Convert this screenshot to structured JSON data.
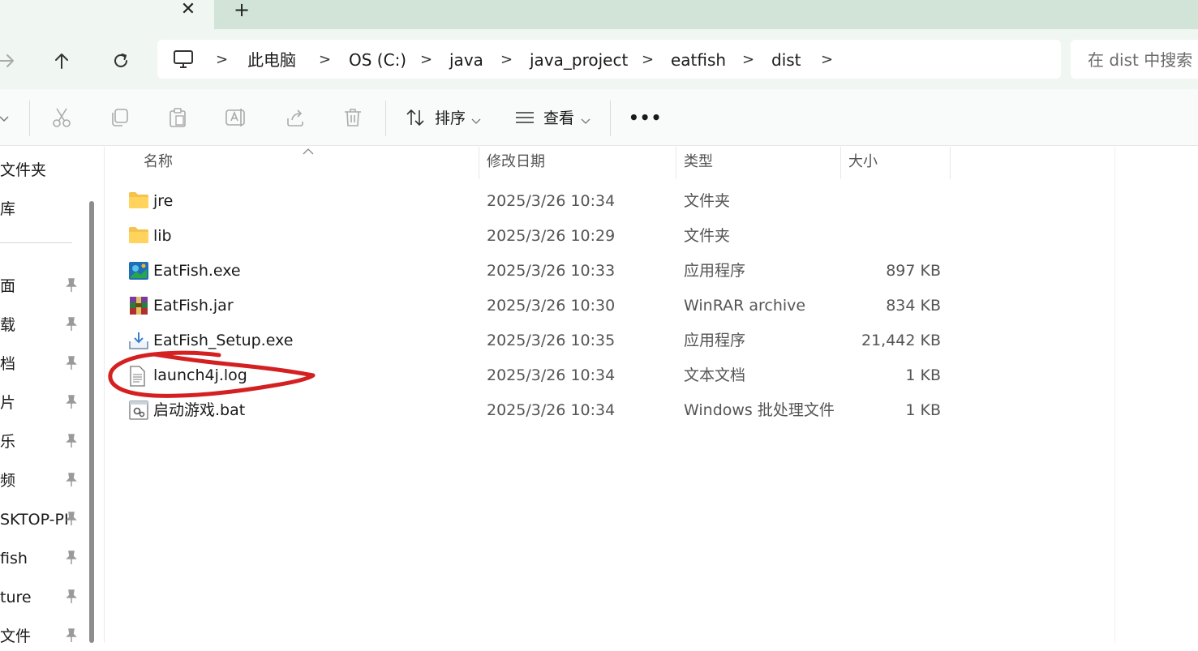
{
  "tabs": {
    "close_glyph": "✕",
    "new_tab_glyph": "+"
  },
  "address": {
    "crumbs": [
      "此电脑",
      "OS (C:)",
      "java",
      "java_project",
      "eatfish",
      "dist"
    ],
    "separator": ">",
    "icon": "computer-icon"
  },
  "search": {
    "placeholder": "在 dist 中搜索"
  },
  "toolbar": {
    "sort_label": "排序",
    "view_label": "查看",
    "more_label": "•••",
    "icons": [
      "cut-icon",
      "copy-icon",
      "paste-icon",
      "rename-icon",
      "share-icon",
      "delete-icon"
    ]
  },
  "sidebar": {
    "items": [
      {
        "label": "文件夹",
        "pinned": false
      },
      {
        "label": "库",
        "pinned": false
      },
      {
        "label": "面",
        "pinned": true
      },
      {
        "label": "载",
        "pinned": true
      },
      {
        "label": "档",
        "pinned": true
      },
      {
        "label": "片",
        "pinned": true
      },
      {
        "label": "乐",
        "pinned": true
      },
      {
        "label": "频",
        "pinned": true
      },
      {
        "label": "SKTOP-PI",
        "pinned": true
      },
      {
        "label": "fish",
        "pinned": true
      },
      {
        "label": "ture",
        "pinned": true
      },
      {
        "label": "文件",
        "pinned": true
      }
    ]
  },
  "columns": {
    "name": "名称",
    "date": "修改日期",
    "type": "类型",
    "size": "大小"
  },
  "files": [
    {
      "name": "jre",
      "date": "2025/3/26 10:34",
      "type": "文件夹",
      "size": "",
      "icon": "folder-icon"
    },
    {
      "name": "lib",
      "date": "2025/3/26 10:29",
      "type": "文件夹",
      "size": "",
      "icon": "folder-icon"
    },
    {
      "name": "EatFish.exe",
      "date": "2025/3/26 10:33",
      "type": "应用程序",
      "size": "897 KB",
      "icon": "exe-icon"
    },
    {
      "name": "EatFish.jar",
      "date": "2025/3/26 10:30",
      "type": "WinRAR archive",
      "size": "834 KB",
      "icon": "winrar-icon"
    },
    {
      "name": "EatFish_Setup.exe",
      "date": "2025/3/26 10:35",
      "type": "应用程序",
      "size": "21,442 KB",
      "icon": "installer-icon"
    },
    {
      "name": "launch4j.log",
      "date": "2025/3/26 10:34",
      "type": "文本文档",
      "size": "1 KB",
      "icon": "text-file-icon"
    },
    {
      "name": "启动游戏.bat",
      "date": "2025/3/26 10:34",
      "type": "Windows 批处理文件",
      "size": "1 KB",
      "icon": "batch-file-icon"
    }
  ],
  "colors": {
    "titlebar": "#d2e4d8",
    "navbar": "#f0f6f2",
    "annotation": "#d42020",
    "folder": "#f4c24d"
  }
}
